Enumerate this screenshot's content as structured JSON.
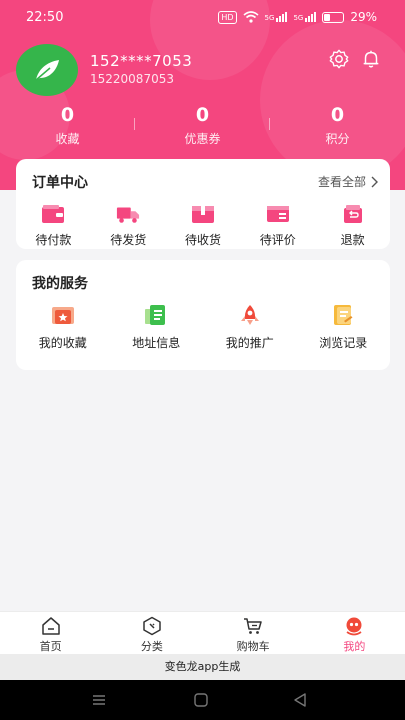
{
  "status_bar": {
    "time": "22:50",
    "hd": "HD",
    "signal1": "5G",
    "signal2": "5G",
    "battery": "29%"
  },
  "profile": {
    "name": "152****7053",
    "subtitle": "15220087053"
  },
  "header_icons": [
    "gear-icon",
    "bell-icon"
  ],
  "stats": [
    {
      "value": "0",
      "label": "收藏"
    },
    {
      "value": "0",
      "label": "优惠券"
    },
    {
      "value": "0",
      "label": "积分"
    }
  ],
  "orders": {
    "title": "订单中心",
    "view_all": "查看全部",
    "items": [
      {
        "label": "待付款",
        "icon": "wallet-icon"
      },
      {
        "label": "待发货",
        "icon": "truck-icon"
      },
      {
        "label": "待收货",
        "icon": "package-icon"
      },
      {
        "label": "待评价",
        "icon": "review-icon"
      },
      {
        "label": "退款",
        "icon": "refund-icon"
      }
    ]
  },
  "services": {
    "title": "我的服务",
    "items": [
      {
        "label": "我的收藏",
        "icon": "star-folder-icon"
      },
      {
        "label": "地址信息",
        "icon": "address-doc-icon"
      },
      {
        "label": "我的推广",
        "icon": "rocket-icon"
      },
      {
        "label": "浏览记录",
        "icon": "history-icon"
      }
    ]
  },
  "bottom_nav": [
    {
      "label": "首页",
      "icon": "home-icon",
      "active": false
    },
    {
      "label": "分类",
      "icon": "category-icon",
      "active": false
    },
    {
      "label": "购物车",
      "icon": "cart-icon",
      "active": false
    },
    {
      "label": "我的",
      "icon": "profile-icon",
      "active": true
    }
  ],
  "footer_credit": "变色龙app生成",
  "colors": {
    "accent": "#f4467f",
    "avatar_green": "#35b54b",
    "background": "#f4f4f6"
  }
}
